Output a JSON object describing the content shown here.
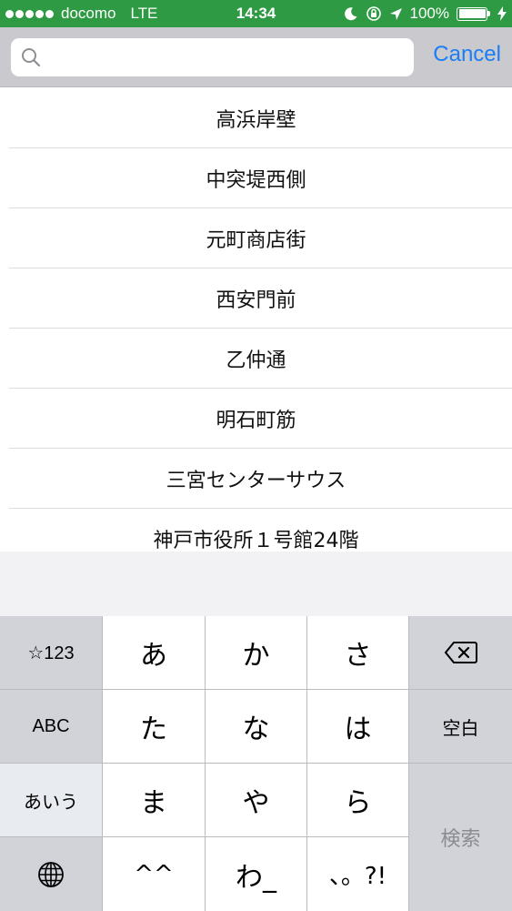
{
  "status_bar": {
    "carrier": "docomo",
    "network": "LTE",
    "time": "14:34",
    "battery": "100%"
  },
  "search": {
    "value": "",
    "placeholder": "",
    "cancel_label": "Cancel"
  },
  "results": [
    "高浜岸壁",
    "中突堤西側",
    "元町商店街",
    "西安門前",
    "乙仲通",
    "明石町筋",
    "三宮センターサウス",
    "神戸市役所１号館24階"
  ],
  "keyboard": {
    "row1": {
      "func": "☆123",
      "keys": [
        "あ",
        "か",
        "さ"
      ],
      "delete_icon": "delete-icon"
    },
    "row2": {
      "func": "ABC",
      "keys": [
        "た",
        "な",
        "は"
      ],
      "space": "空白"
    },
    "row3": {
      "func": "あいう",
      "keys": [
        "ま",
        "や",
        "ら"
      ]
    },
    "row4": {
      "globe_icon": "globe-icon",
      "keys": [
        "^^",
        "わ_",
        "、。?!"
      ]
    },
    "search_key": "検索"
  },
  "colors": {
    "status_bar": "#2e9a44",
    "accent": "#1a7ef5"
  }
}
